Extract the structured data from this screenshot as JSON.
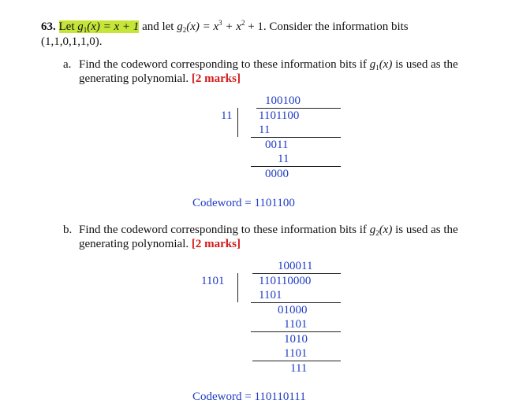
{
  "question": {
    "number": "63.",
    "intro_lead": "Let",
    "g1_def_symbol": "g",
    "g1_sub": "1",
    "g1_expr": "(x) = x + 1",
    "g2_intro": "and let",
    "g2_symbol": "g",
    "g2_sub": "2",
    "g2_expr_a": "(x) = x",
    "g2_exp1": "3",
    "g2_expr_b": " + x",
    "g2_exp2": "2",
    "g2_expr_c": " + 1.",
    "consider_text": "Consider the information bits",
    "info_bits": "(1,1,0,1,1,0)."
  },
  "part_a": {
    "label": "a.",
    "text_line1": "Find the codeword corresponding to these information bits if",
    "g_symbol": "g",
    "g_sub": "1",
    "g_arg": "(x)",
    "text_line1_end": "is used as the",
    "text_line2": "generating polynomial.",
    "marks": "[2 marks]",
    "division": {
      "quotient": "100100",
      "divisor": "11",
      "dividend": "1101100",
      "steps": [
        "11",
        "0011",
        "11",
        "0000"
      ]
    },
    "codeword": "Codeword = 1101100"
  },
  "part_b": {
    "label": "b.",
    "text_line1": "Find the codeword corresponding to these information bits if",
    "g_symbol": "g",
    "g_sub": "2",
    "g_arg": "(x)",
    "text_line1_end": "is used as the",
    "text_line2": "generating polynomial.",
    "marks": "[2 marks]",
    "division": {
      "quotient": "100011",
      "divisor": "1101",
      "dividend": "110110000",
      "steps": [
        "1101",
        "01000",
        "1101",
        "1010",
        "1101",
        "111"
      ]
    },
    "codeword": "Codeword = 110110111"
  },
  "colors": {
    "highlight": "#c5e639",
    "marks_red": "#d11a1a",
    "math_blue": "#1f3cc4"
  }
}
